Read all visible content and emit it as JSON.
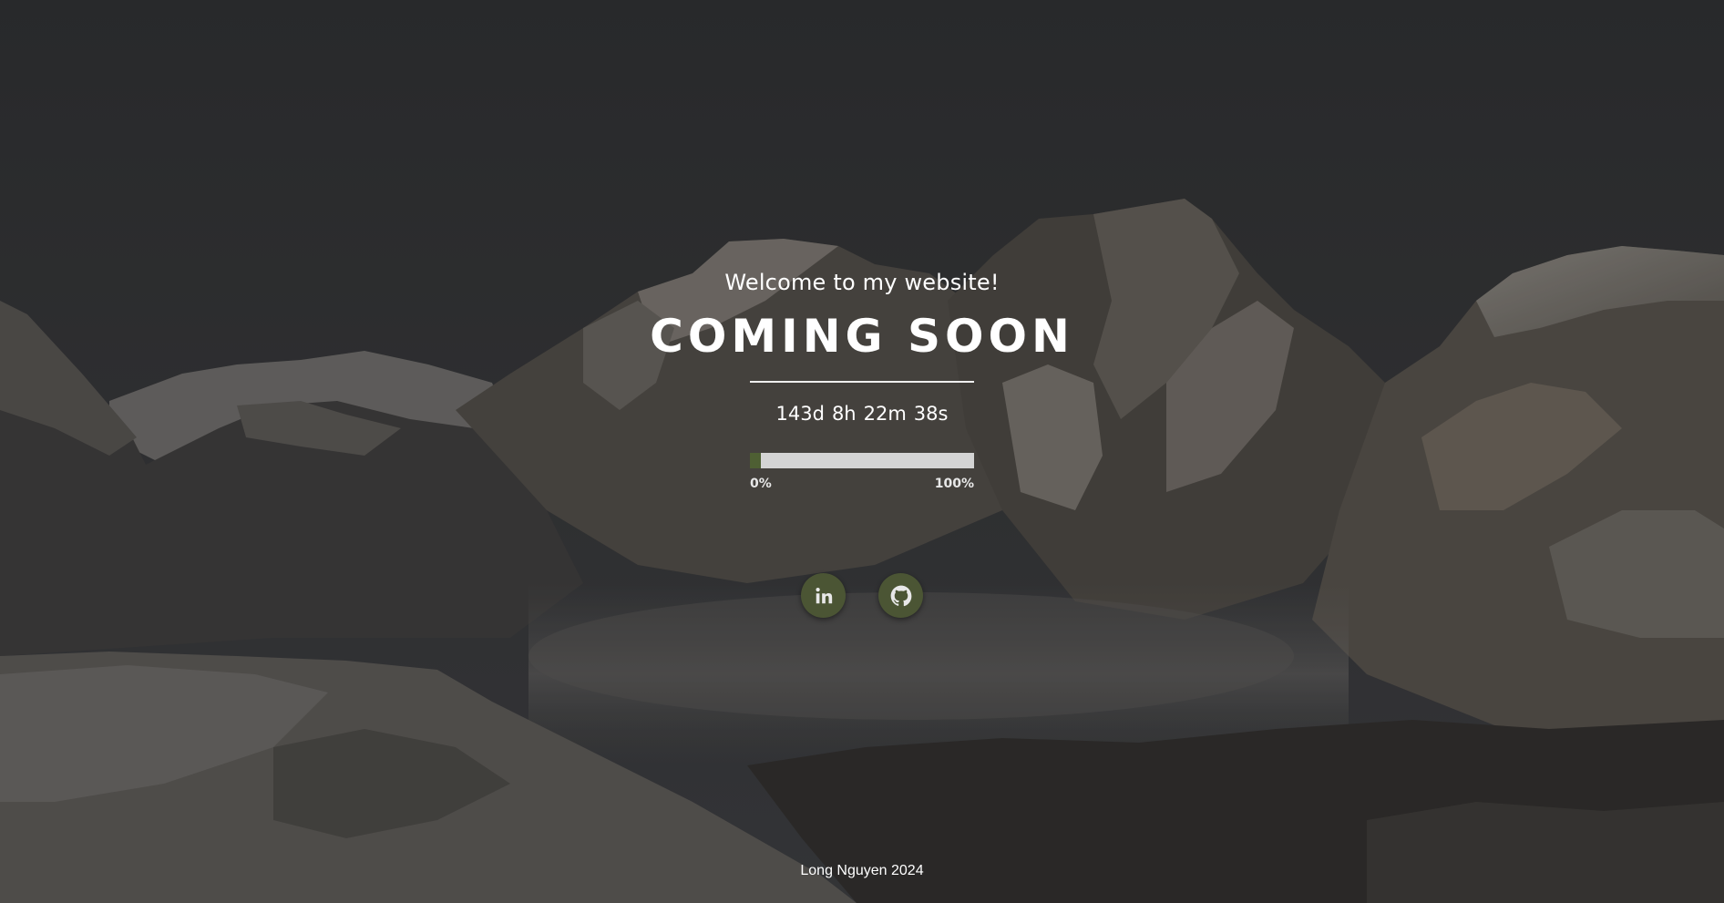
{
  "hero": {
    "welcome": "Welcome to my website!",
    "title": "COMING SOON"
  },
  "countdown": {
    "days": "143d",
    "hours": "8h",
    "minutes": "22m",
    "seconds": "38s"
  },
  "progress": {
    "percent": 5,
    "label_start": "0%",
    "label_end": "100%",
    "fill_color": "#4e5f33",
    "track_color": "#d4d4d4"
  },
  "social": {
    "links": [
      {
        "name": "linkedin",
        "icon": "linkedin-icon"
      },
      {
        "name": "github",
        "icon": "github-icon"
      }
    ],
    "button_color": "#4b5534"
  },
  "footer": {
    "text": "Long Nguyen 2024"
  }
}
